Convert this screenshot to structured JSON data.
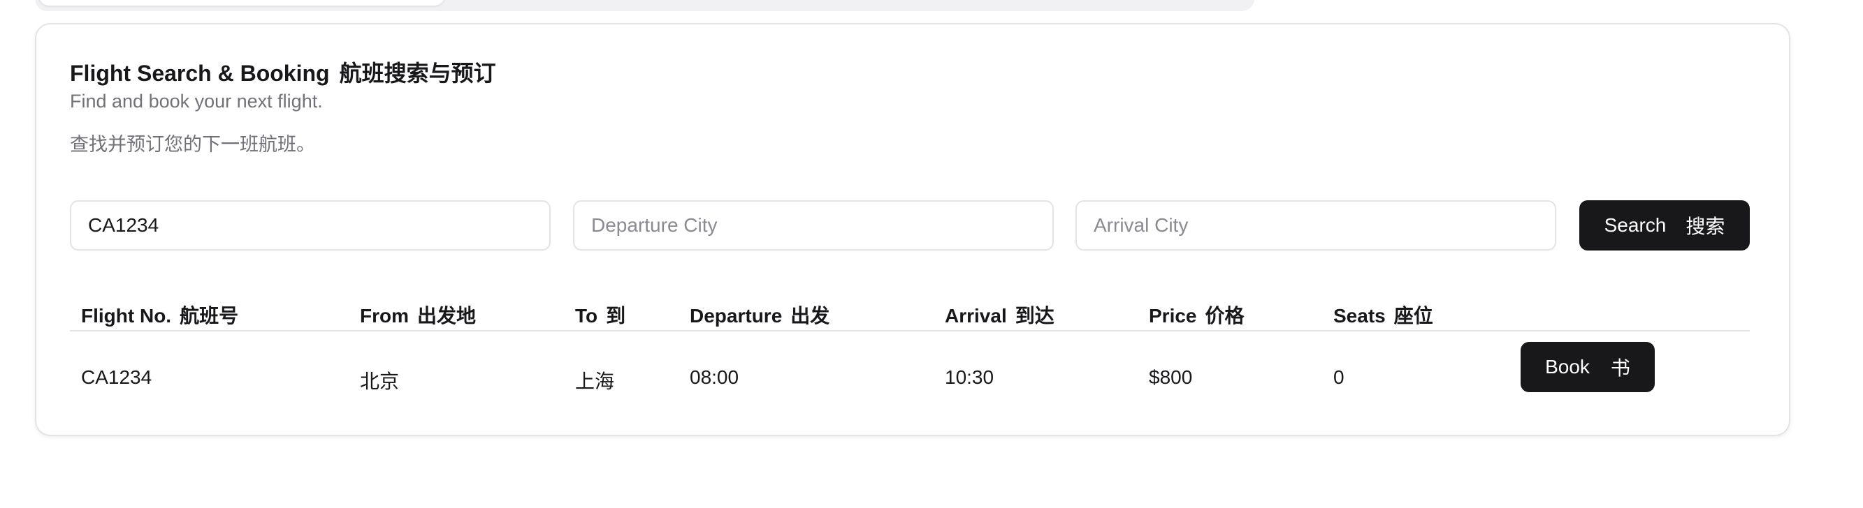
{
  "card": {
    "title": "Flight Search & Booking",
    "title_zh": "航班搜索与预订",
    "subtitle": "Find and book your next flight.",
    "subtitle_zh": "查找并预订您的下一班航班。"
  },
  "search": {
    "flight_number_value": "CA1234",
    "departure_placeholder": "Departure City",
    "departure_value": "",
    "arrival_placeholder": "Arrival City",
    "arrival_value": "",
    "button_label": "Search",
    "button_label_zh": "搜索"
  },
  "table": {
    "columns": [
      {
        "label": "Flight No.",
        "label_zh": "航班号"
      },
      {
        "label": "From",
        "label_zh": "出发地"
      },
      {
        "label": "To",
        "label_zh": "到"
      },
      {
        "label": "Departure",
        "label_zh": "出发"
      },
      {
        "label": "Arrival",
        "label_zh": "到达"
      },
      {
        "label": "Price",
        "label_zh": "价格"
      },
      {
        "label": "Seats",
        "label_zh": "座位"
      }
    ],
    "rows": [
      {
        "flight_no": "CA1234",
        "from": "北京",
        "to": "上海",
        "departure": "08:00",
        "arrival": "10:30",
        "price": "$800",
        "seats": "0",
        "book_label": "Book",
        "book_label_zh": "书"
      }
    ]
  },
  "colors": {
    "primary_button": "#18181b",
    "muted_text": "#71717a",
    "border": "#e4e4e7"
  }
}
